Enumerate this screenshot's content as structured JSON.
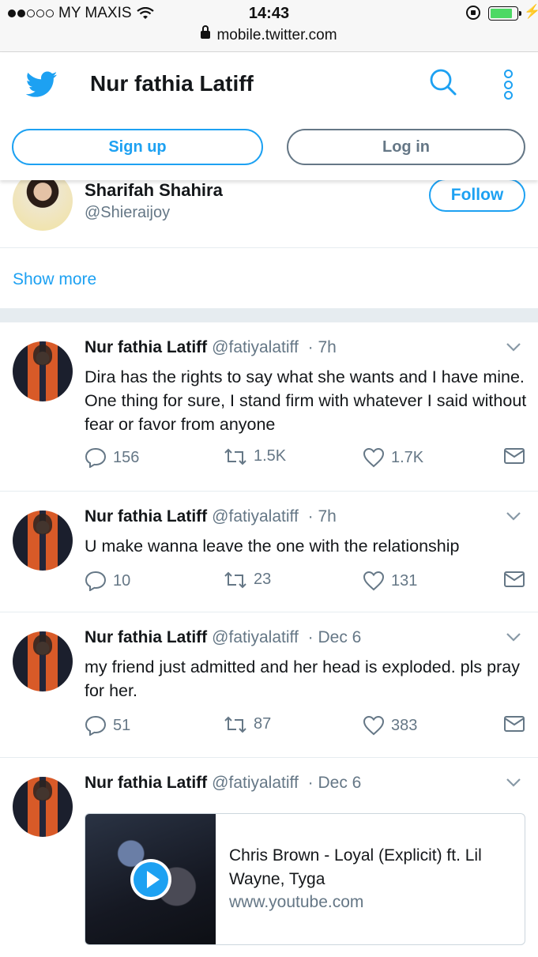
{
  "status_bar": {
    "carrier": "MY MAXIS",
    "time": "14:43",
    "url": "mobile.twitter.com",
    "battery_level": 0.85
  },
  "header": {
    "title": "Nur fathia Latiff",
    "signup_label": "Sign up",
    "login_label": "Log in"
  },
  "suggestion": {
    "name": "Sharifah Shahira",
    "handle": "@Shieraijoy",
    "follow_label": "Follow"
  },
  "show_more": "Show more",
  "colors": {
    "accent": "#1da1f2",
    "secondary_text": "#657786",
    "divider": "#e6ecf0"
  },
  "tweets": [
    {
      "name": "Nur fathia Latiff",
      "handle": "@fatiyalatiff",
      "time": "· 7h",
      "text": "Dira has the rights to say what she wants and I have mine. One thing for sure, I stand firm with whatever I said without fear or favor from anyone",
      "replies": "156",
      "retweets": "1.5K",
      "likes": "1.7K"
    },
    {
      "name": "Nur fathia Latiff",
      "handle": "@fatiyalatiff",
      "time": "· 7h",
      "text": "U make wanna leave the one with the relationship",
      "replies": "10",
      "retweets": "23",
      "likes": "131"
    },
    {
      "name": "Nur fathia Latiff",
      "handle": "@fatiyalatiff",
      "time": "· Dec 6",
      "text": "my friend just admitted and her head is exploded. pls pray for her.",
      "replies": "51",
      "retweets": "87",
      "likes": "383"
    },
    {
      "name": "Nur fathia Latiff",
      "handle": "@fatiyalatiff",
      "time": "· Dec 6",
      "card_title": "Chris Brown - Loyal (Explicit) ft. Lil Wayne, Tyga",
      "card_url": "www.youtube.com"
    }
  ]
}
